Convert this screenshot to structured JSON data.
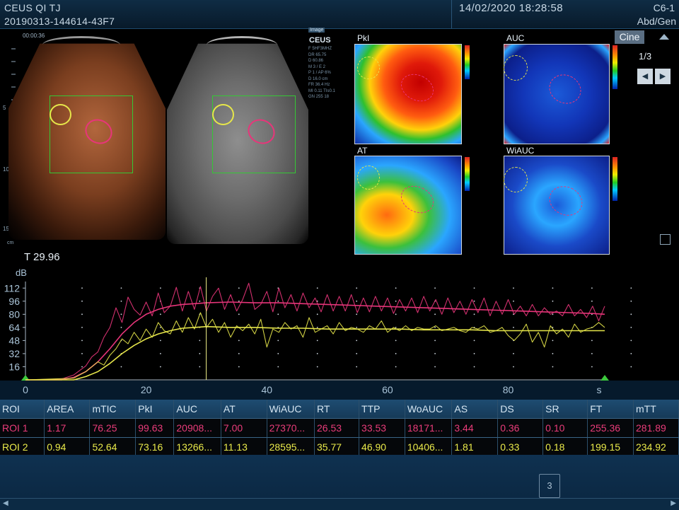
{
  "header": {
    "title": "CEUS QI TJ",
    "exam_id": "20190313-144614-43F7",
    "datetime": "14/02/2020   18:28:58",
    "probe": "C6-1",
    "preset": "Abd/Gen"
  },
  "image_panel": {
    "timer": "00:00:36",
    "side_image_tag": "Image",
    "mode": "CEUS",
    "params": [
      "F 5HF3MHZ",
      "DR 65.75",
      "D 60.86",
      "M 3 / E 2",
      "P 1 / AP 6%",
      "D 16.0 cm",
      "FR 36.4 Hz",
      "MI 0.11 TIs0.1",
      "GN 255 18"
    ],
    "depth_ticks": [
      "5",
      "10",
      "15"
    ],
    "depth_unit": "cm"
  },
  "maps": [
    {
      "id": "pkl",
      "label": "PkI"
    },
    {
      "id": "auc",
      "label": "AUC"
    },
    {
      "id": "at",
      "label": "AT"
    },
    {
      "id": "wiauc",
      "label": "WiAUC"
    }
  ],
  "controls": {
    "cine_label": "Cine",
    "page": "1/3",
    "prev_icon": "left-triangle-icon",
    "next_icon": "right-triangle-icon",
    "frame_count": "3"
  },
  "cursor_time": "T 29.96",
  "chart_data": {
    "type": "line",
    "xlabel": "s",
    "ylabel": "dB",
    "xlim": [
      0,
      96
    ],
    "ylim": [
      0,
      120
    ],
    "x_ticks": [
      0,
      20,
      40,
      60,
      80
    ],
    "y_ticks": [
      16,
      32,
      48,
      64,
      80,
      96,
      112
    ],
    "cursor_x": 29.96,
    "series": [
      {
        "color": "#e8357a",
        "kind": "raw",
        "x": [
          0,
          6,
          8,
          10,
          11,
          12,
          13,
          14,
          15,
          16,
          17,
          18,
          19,
          20,
          21,
          22,
          23,
          24,
          25,
          26,
          27,
          28,
          29,
          30,
          31,
          32,
          33,
          34,
          35,
          36,
          37,
          38,
          39,
          40,
          41,
          42,
          43,
          44,
          45,
          46,
          47,
          48,
          49,
          50,
          51,
          52,
          53,
          54,
          55,
          56,
          57,
          58,
          59,
          60,
          61,
          62,
          63,
          64,
          65,
          66,
          67,
          68,
          69,
          70,
          71,
          72,
          73,
          74,
          75,
          76,
          77,
          78,
          79,
          80,
          81,
          82,
          83,
          84,
          85,
          86,
          87,
          88,
          89,
          90,
          91,
          92,
          93,
          94,
          95,
          96
        ],
        "y": [
          0,
          1,
          6,
          17,
          28,
          34,
          52,
          64,
          88,
          70,
          101,
          86,
          79,
          95,
          78,
          106,
          82,
          90,
          113,
          84,
          108,
          86,
          114,
          84,
          102,
          112,
          86,
          104,
          84,
          98,
          118,
          86,
          92,
          108,
          83,
          112,
          88,
          104,
          84,
          106,
          88,
          100,
          83,
          104,
          84,
          102,
          84,
          104,
          82,
          100,
          83,
          102,
          84,
          100,
          81,
          98,
          84,
          100,
          82,
          102,
          84,
          98,
          80,
          100,
          82,
          96,
          80,
          98,
          82,
          100,
          78,
          96,
          80,
          98,
          80,
          90,
          78,
          92,
          78,
          88,
          80,
          84,
          78,
          92,
          78,
          86,
          76,
          90,
          72,
          90
        ]
      },
      {
        "color": "#e8357a",
        "kind": "fit",
        "x": [
          0,
          6,
          8,
          10,
          12,
          14,
          16,
          18,
          20,
          22,
          24,
          26,
          28,
          30,
          34,
          38,
          42,
          46,
          50,
          54,
          58,
          62,
          66,
          70,
          74,
          78,
          82,
          86,
          90,
          94,
          96
        ],
        "y": [
          0,
          0,
          3,
          10,
          22,
          38,
          56,
          70,
          80,
          86,
          90,
          92,
          93,
          94,
          95,
          94,
          94,
          93,
          92,
          91,
          90,
          89,
          88,
          87,
          86,
          85,
          84,
          83,
          82,
          81,
          80
        ]
      },
      {
        "color": "#e6e64a",
        "kind": "raw",
        "x": [
          0,
          8,
          10,
          11,
          12,
          13,
          14,
          15,
          16,
          17,
          18,
          19,
          20,
          21,
          22,
          23,
          24,
          25,
          26,
          27,
          28,
          29,
          30,
          31,
          32,
          33,
          34,
          35,
          36,
          37,
          38,
          39,
          40,
          41,
          42,
          43,
          44,
          45,
          46,
          47,
          48,
          49,
          50,
          51,
          52,
          53,
          54,
          55,
          56,
          57,
          58,
          59,
          60,
          61,
          62,
          63,
          64,
          65,
          66,
          67,
          68,
          69,
          70,
          71,
          72,
          73,
          74,
          75,
          76,
          77,
          78,
          79,
          80,
          81,
          82,
          83,
          84,
          85,
          86,
          87,
          88,
          89,
          90,
          91,
          92,
          93,
          94,
          95,
          96
        ],
        "y": [
          0,
          2,
          10,
          16,
          22,
          18,
          30,
          38,
          50,
          44,
          58,
          48,
          62,
          52,
          70,
          60,
          56,
          72,
          58,
          76,
          62,
          82,
          64,
          74,
          58,
          70,
          52,
          66,
          60,
          68,
          56,
          74,
          40,
          62,
          58,
          70,
          62,
          66,
          52,
          76,
          58,
          62,
          66,
          56,
          70,
          60,
          64,
          62,
          58,
          66,
          62,
          72,
          58,
          64,
          60,
          66,
          60,
          64,
          62,
          62,
          66,
          60,
          62,
          64,
          60,
          58,
          64,
          62,
          66,
          58,
          60,
          64,
          54,
          48,
          56,
          68,
          46,
          58,
          40,
          66,
          56,
          62,
          52,
          68,
          58,
          62,
          64,
          70,
          64
        ]
      },
      {
        "color": "#e6e64a",
        "kind": "fit",
        "x": [
          0,
          8,
          10,
          12,
          14,
          16,
          18,
          20,
          22,
          24,
          26,
          28,
          30,
          34,
          38,
          42,
          46,
          50,
          54,
          58,
          62,
          66,
          70,
          74,
          78,
          82,
          86,
          90,
          94,
          96
        ],
        "y": [
          0,
          0,
          4,
          10,
          20,
          32,
          42,
          50,
          56,
          60,
          63,
          64,
          65,
          64,
          64,
          63,
          63,
          62,
          62,
          62,
          62,
          61,
          61,
          61,
          60,
          60,
          60,
          60,
          60,
          60
        ]
      }
    ]
  },
  "results": {
    "headers": [
      "ROI",
      "AREA",
      "mTIC",
      "PkI",
      "AUC",
      "AT",
      "WiAUC",
      "RT",
      "TTP",
      "WoAUC",
      "AS",
      "DS",
      "SR",
      "FT",
      "mTT"
    ],
    "rows": [
      [
        "ROI 1",
        "1.17",
        "76.25",
        "99.63",
        "20908...",
        "7.00",
        "27370...",
        "26.53",
        "33.53",
        "18171...",
        "3.44",
        "0.36",
        "0.10",
        "255.36",
        "281.89"
      ],
      [
        "ROI 2",
        "0.94",
        "52.64",
        "73.16",
        "13266...",
        "11.13",
        "28595...",
        "35.77",
        "46.90",
        "10406...",
        "1.81",
        "0.33",
        "0.18",
        "199.15",
        "234.92"
      ]
    ]
  }
}
